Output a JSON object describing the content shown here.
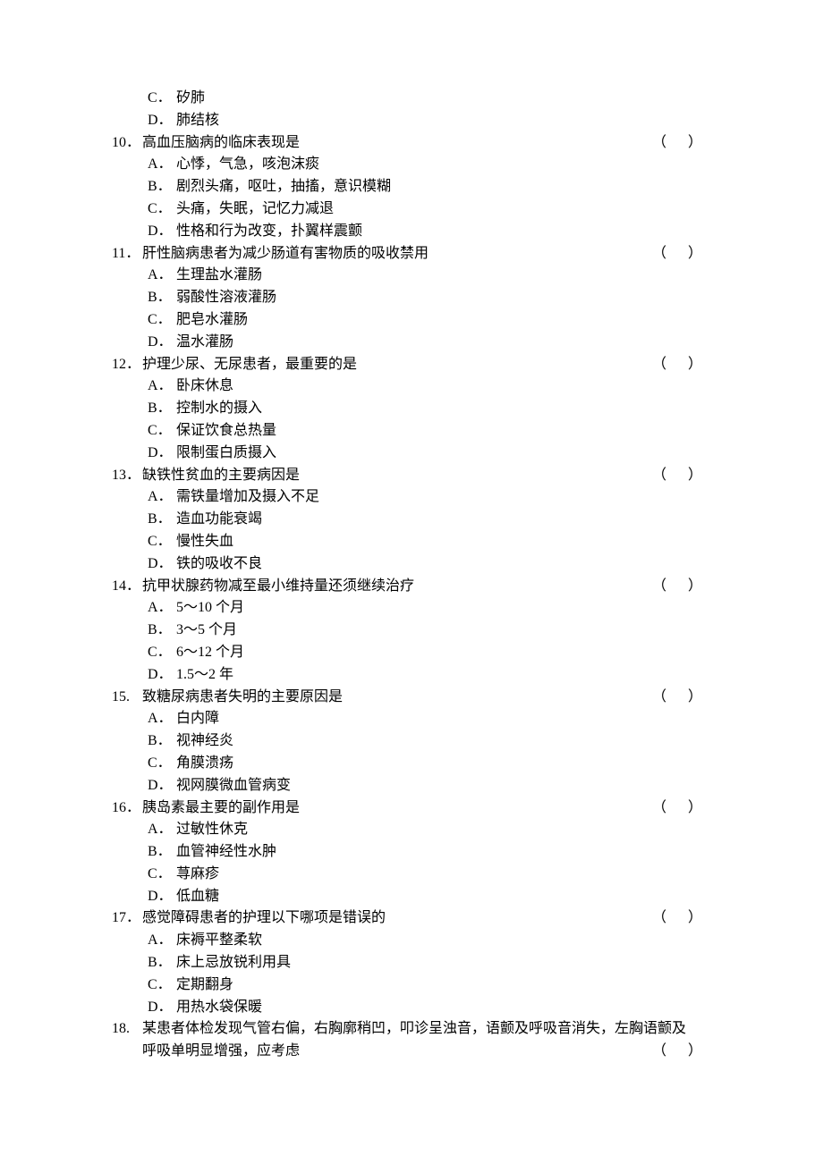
{
  "orphan_options": [
    {
      "letter": "C．",
      "text": "矽肺"
    },
    {
      "letter": "D．",
      "text": "肺结核"
    }
  ],
  "questions": [
    {
      "num": "10．",
      "text": "高血压脑病的临床表现是",
      "paren": "（   ）",
      "options": [
        {
          "letter": "A．",
          "text": "心悸，气急，咳泡沫痰"
        },
        {
          "letter": "B．",
          "text": "剧烈头痛，呕吐，抽搐，意识模糊"
        },
        {
          "letter": "C．",
          "text": "头痛，失眠，记忆力减退"
        },
        {
          "letter": "D．",
          "text": "性格和行为改变，扑翼样震颤"
        }
      ]
    },
    {
      "num": "11．",
      "text": "肝性脑病患者为减少肠道有害物质的吸收禁用",
      "paren": "（   ）",
      "options": [
        {
          "letter": "A．",
          "text": " 生理盐水灌肠"
        },
        {
          "letter": "B．",
          "text": "弱酸性溶液灌肠"
        },
        {
          "letter": "C．",
          "text": "肥皂水灌肠"
        },
        {
          "letter": "D．",
          "text": "温水灌肠"
        }
      ]
    },
    {
      "num": "12．",
      "text": "护理少尿、无尿患者，最重要的是",
      "paren": "（   ）",
      "options": [
        {
          "letter": "A．",
          "text": "卧床休息"
        },
        {
          "letter": "B．",
          "text": "控制水的摄入"
        },
        {
          "letter": "C．",
          "text": "保证饮食总热量"
        },
        {
          "letter": "D．",
          "text": "限制蛋白质摄入"
        }
      ]
    },
    {
      "num": "13．",
      "text": "缺铁性贫血的主要病因是",
      "paren": "（   ）",
      "options": [
        {
          "letter": "A．",
          "text": "需铁量增加及摄入不足"
        },
        {
          "letter": "B．",
          "text": "造血功能衰竭"
        },
        {
          "letter": "C．",
          "text": "慢性失血"
        },
        {
          "letter": "D．",
          "text": "铁的吸收不良"
        }
      ]
    },
    {
      "num": "14．",
      "text": "抗甲状腺药物减至最小维持量还须继续治疗",
      "paren": "（   ）",
      "options": [
        {
          "letter": "A．",
          "text": "5～10 个月"
        },
        {
          "letter": "B．",
          "text": "3～5 个月"
        },
        {
          "letter": "C．",
          "text": "6～12 个月"
        },
        {
          "letter": "D．",
          "text": "1.5～2 年"
        }
      ]
    },
    {
      "num": "15.",
      "text": "致糖尿病患者失明的主要原因是",
      "paren": "（   ）",
      "options": [
        {
          "letter": "A．",
          "text": "白内障"
        },
        {
          "letter": "B．",
          "text": "视神经炎"
        },
        {
          "letter": "C．",
          "text": "角膜溃疡"
        },
        {
          "letter": "D．",
          "text": "视网膜微血管病变"
        }
      ]
    },
    {
      "num": "16．",
      "text": "胰岛素最主要的副作用是",
      "paren": "（   ）",
      "options": [
        {
          "letter": "A．",
          "text": "过敏性休克"
        },
        {
          "letter": "B．",
          "text": "血管神经性水肿"
        },
        {
          "letter": "C．",
          "text": "荨麻疹"
        },
        {
          "letter": "D．",
          "text": "低血糖"
        }
      ]
    },
    {
      "num": "17．",
      "text": "感觉障碍患者的护理以下哪项是错误的",
      "paren": "（   ）",
      "options": [
        {
          "letter": "A．",
          "text": "床褥平整柔软"
        },
        {
          "letter": "B．",
          "text": "床上忌放锐利用具"
        },
        {
          "letter": "C．",
          "text": "定期翻身"
        },
        {
          "letter": "D．",
          "text": "用热水袋保暖"
        }
      ]
    }
  ],
  "q18": {
    "num": "18.",
    "line1": "某患者体检发现气管右偏，右胸廓稍凹，叩诊呈浊音，语颤及呼吸音消失，左胸语颤及",
    "line2": "呼吸单明显增强，应考虑",
    "paren": "（   ）"
  }
}
